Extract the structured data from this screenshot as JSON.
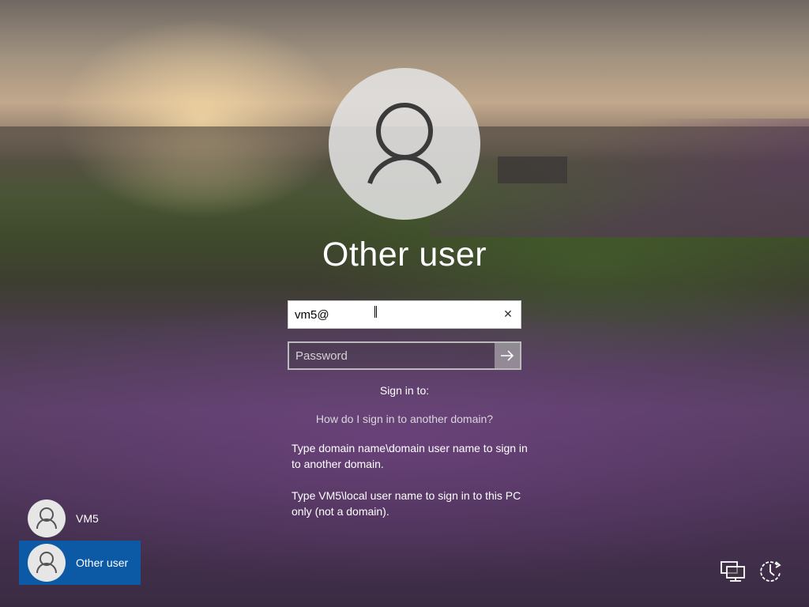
{
  "login": {
    "display_name": "Other user",
    "username_value": "vm5@",
    "password_placeholder": "Password",
    "sign_in_to_label": "Sign in to:",
    "help_link": "How do I sign in to another domain?",
    "help_text_1": "Type domain name\\domain user name to sign in to another domain.",
    "help_text_2": "Type VM5\\local user name to sign in to this PC only (not a domain).",
    "clear_icon": "close-icon",
    "submit_icon": "arrow-right-icon"
  },
  "user_list": [
    {
      "label": "VM5",
      "selected": false
    },
    {
      "label": "Other user",
      "selected": true
    }
  ],
  "corner_icons": [
    "network-icon",
    "accessibility-icon"
  ],
  "colors": {
    "selected_tile": "#0c5aa6",
    "avatar_bg": "#e6e6e6"
  }
}
